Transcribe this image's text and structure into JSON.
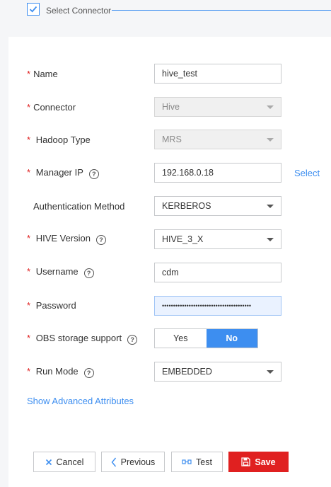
{
  "wizard": {
    "step_label": "Select Connector"
  },
  "form": {
    "name": {
      "label": "Name",
      "value": "hive_test"
    },
    "connector": {
      "label": "Connector",
      "value": "Hive"
    },
    "hadoop_type": {
      "label": "Hadoop Type",
      "value": "MRS"
    },
    "manager_ip": {
      "label": "Manager IP",
      "value": "192.168.0.18",
      "select_link": "Select"
    },
    "auth_method": {
      "label": "Authentication Method",
      "value": "KERBEROS"
    },
    "hive_version": {
      "label": "HIVE Version",
      "value": "HIVE_3_X"
    },
    "username": {
      "label": "Username",
      "value": "cdm"
    },
    "password": {
      "label": "Password",
      "value": "••••••••••••••••••••••••••••••••••••••••"
    },
    "obs_support": {
      "label": "OBS storage support",
      "options": [
        "Yes",
        "No"
      ],
      "selected": "No"
    },
    "run_mode": {
      "label": "Run Mode",
      "value": "EMBEDDED"
    },
    "advanced_link": "Show Advanced Attributes"
  },
  "footer": {
    "cancel": "Cancel",
    "previous": "Previous",
    "test": "Test",
    "save": "Save"
  },
  "colors": {
    "accent": "#3d8ef0",
    "required_star": "#e02020",
    "primary_button": "#e02020"
  },
  "icons": [
    "checkbox-checked-icon",
    "help-icon",
    "chevron-down-icon",
    "close-icon",
    "chevron-left-icon",
    "connection-test-icon",
    "save-icon"
  ]
}
